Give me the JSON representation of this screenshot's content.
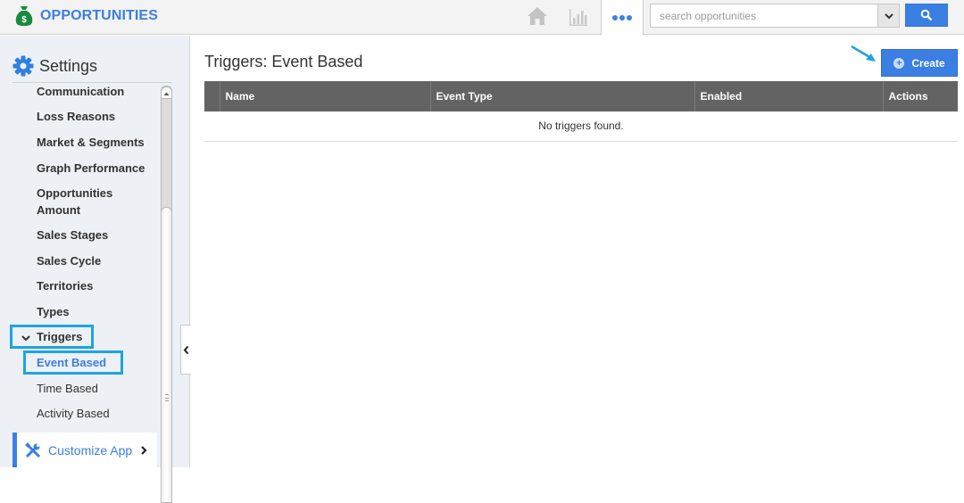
{
  "app": {
    "title": "OPPORTUNITIES",
    "brand_color": "#3b7fe3",
    "logo_icon": "money-bag-icon"
  },
  "topnav": {
    "home_icon": "home-icon",
    "reports_icon": "bar-chart-icon",
    "more_icon": "more-dots-icon",
    "search": {
      "placeholder": "search opportunities",
      "value": "",
      "dropdown_icon": "chevron-down-icon",
      "button_icon": "search-icon"
    }
  },
  "sidebar": {
    "title": "Settings",
    "title_icon": "gear-icon",
    "items": [
      {
        "label": "Communication"
      },
      {
        "label": "Loss Reasons"
      },
      {
        "label": "Market & Segments"
      },
      {
        "label": "Graph Performance"
      },
      {
        "label": "Opportunities"
      },
      {
        "label": "Amount"
      },
      {
        "label": "Sales Stages"
      },
      {
        "label": "Sales Cycle"
      },
      {
        "label": "Territories"
      },
      {
        "label": "Types"
      },
      {
        "label": "Triggers",
        "expanded": true
      },
      {
        "label": "Event Based",
        "active": true
      },
      {
        "label": "Time Based"
      },
      {
        "label": "Activity Based"
      }
    ],
    "customize": {
      "label": "Customize App",
      "icon": "tools-icon"
    },
    "highlight_color": "#1fa4e0"
  },
  "main": {
    "title": "Triggers: Event Based",
    "create_label": "Create",
    "table": {
      "columns": [
        "",
        "Name",
        "Event Type",
        "Enabled",
        "Actions"
      ],
      "empty_message": "No triggers found."
    }
  }
}
